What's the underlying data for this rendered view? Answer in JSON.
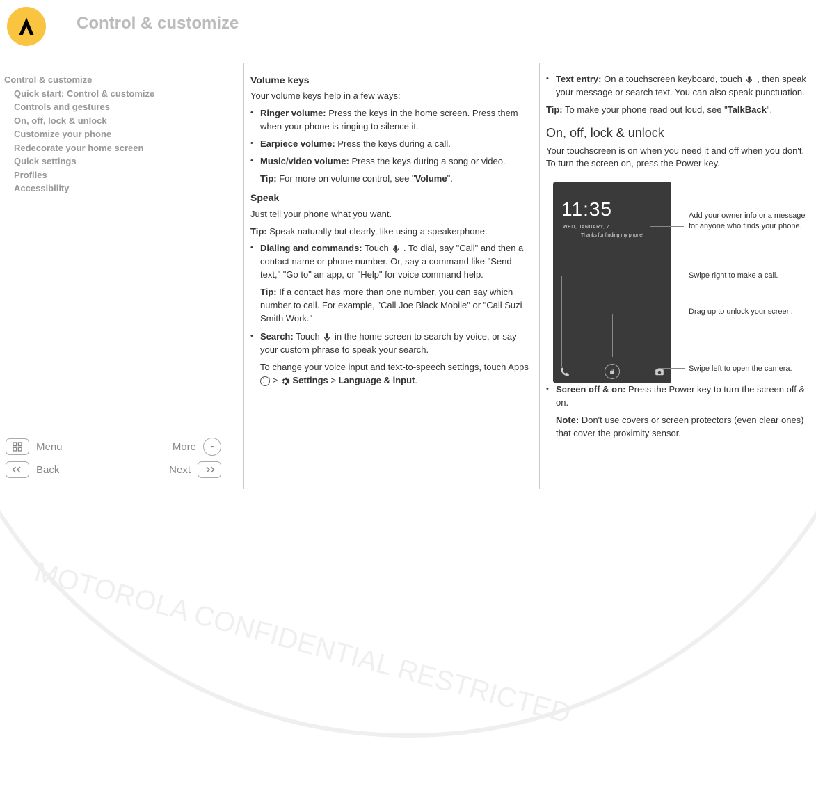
{
  "header": {
    "title": "Control & customize"
  },
  "sidebar": {
    "top": "Control & customize",
    "items": [
      "Quick start: Control & customize",
      "Controls and gestures",
      "On, off, lock & unlock",
      "Customize your phone",
      "Redecorate your home screen",
      "Quick settings",
      "Profiles",
      "Accessibility"
    ]
  },
  "nav": {
    "menu": "Menu",
    "more": "More",
    "back": "Back",
    "next": "Next"
  },
  "col1": {
    "volume_keys_h": "Volume keys",
    "volume_intro": "Your volume keys help in a few ways:",
    "ringer_label": "Ringer volume:",
    "ringer_text": " Press the keys in the home screen. Press them when your phone is ringing to silence it.",
    "earpiece_label": "Earpiece volume:",
    "earpiece_text": " Press the keys during a call.",
    "music_label": "Music/video volume:",
    "music_text": " Press the keys during a song or video.",
    "vol_tip_prefix": "Tip:",
    "vol_tip_text": " For more on volume control, see \"",
    "vol_tip_link": "Volume",
    "vol_tip_end": "\".",
    "speak_h": "Speak",
    "speak_intro": "Just tell your phone what you want.",
    "speak_tip_prefix": "Tip:",
    "speak_tip_text": " Speak naturally but clearly, like using a speakerphone.",
    "dialing_label": "Dialing and commands:",
    "dialing_touch": " Touch ",
    "dialing_rest": " . To dial, say \"Call\" and then a contact name or phone number. Or, say a command like \"Send text,\" \"Go to\" an app, or \"Help\" for voice command help.",
    "dialing_tip_prefix": "Tip:",
    "dialing_tip_text": " If a contact has more than one number, you can say which number to call. For example, \"Call Joe Black Mobile\" or \"Call Suzi Smith Work.\"",
    "search_label": "Search:",
    "search_touch": " Touch ",
    "search_rest": " in the home screen to search by voice, or say your custom phrase to speak your search.",
    "change_voice_pre": "To change your voice input and text-to-speech settings, touch Apps ",
    "arrow": " > ",
    "settings_label": " Settings",
    "lang_input": "Language & input",
    "period": "."
  },
  "col2": {
    "text_entry_label": "Text entry:",
    "text_entry_pre": " On a touchscreen keyboard, touch ",
    "text_entry_post": " , then speak your message or search text. You can also speak punctuation.",
    "tip_prefix": "Tip:",
    "tip_readout": " To make your phone read out loud, see \"",
    "talkback": "TalkBack",
    "tip_end": "\".",
    "onoff_h": "On, off, lock & unlock",
    "onoff_intro": "Your touchscreen is on when you need it and off when you don't. To turn the screen on, press the Power key.",
    "phone_time": "11:35",
    "phone_date": "WED, JANUARY, 7",
    "phone_msg": "Thanks for finding my phone!",
    "ann_owner": "Add your owner info or a message for anyone who finds your phone.",
    "ann_swipe_right": "Swipe right to make a call.",
    "ann_drag_up": "Drag up to unlock your screen.",
    "ann_swipe_left": "Swipe left to open the camera.",
    "screen_off_label": "Screen off & on:",
    "screen_off_text": " Press the Power key to turn the screen off & on.",
    "note_prefix": "Note:",
    "note_text": " Don't use covers or screen protectors (even clear ones) that cover the proximity sensor."
  }
}
